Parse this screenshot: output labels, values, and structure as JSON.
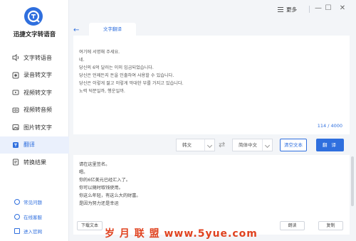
{
  "app": {
    "name": "迅捷文字转语音",
    "brand_color": "#2f6fde"
  },
  "titlebar": {
    "menu_label": "更多",
    "minimize": "—",
    "maximize": "☐",
    "close": "✕"
  },
  "sidebar": {
    "items": [
      {
        "label": "文字转语音",
        "icon": "text-to-speech-icon",
        "active": false
      },
      {
        "label": "录音转文字",
        "icon": "recording-icon",
        "active": false
      },
      {
        "label": "视频转文字",
        "icon": "video-icon",
        "active": false
      },
      {
        "label": "视频转音频",
        "icon": "video-audio-icon",
        "active": false
      },
      {
        "label": "图片转文字",
        "icon": "image-icon",
        "active": false
      },
      {
        "label": "翻译",
        "icon": "translate-icon",
        "active": true
      },
      {
        "label": "转换结果",
        "icon": "result-icon",
        "active": false
      }
    ],
    "bottom_links": [
      {
        "label": "常见问题",
        "icon": "faq-icon"
      },
      {
        "label": "在线客服",
        "icon": "support-icon"
      },
      {
        "label": "进入官网",
        "icon": "website-icon"
      }
    ]
  },
  "tabs": {
    "back": "←",
    "active_tab": "文字翻译"
  },
  "input": {
    "lines": [
      "여기에 서명해 주세요.",
      "네.",
      "당신의 6억 달러는 이미 입금되었습니다.",
      "당신은 언제든지 돈을 인출하여 사용할 수 있습니다.",
      "당신은 이렇게 젊고 이렇게 막대한 부를 가지고 있습니다.",
      "노력 덕분일까, 행운일까."
    ],
    "counter": "114 / 4000"
  },
  "controls": {
    "source_lang": "韩文",
    "target_lang": "简体中文",
    "swap": "⇄",
    "clear_label": "清空文本",
    "translate_label": "翻 译"
  },
  "output": {
    "lines": [
      "请在这里签名。",
      "嗯。",
      "你的6亿美元已经汇入了。",
      "你可以随时取钱使用。",
      "你这么年轻，有这么大的财富。",
      "是因为努力还是幸运"
    ],
    "download_label": "下载文本",
    "read_label": "朗读",
    "copy_label": "复制"
  },
  "watermark": "岁 月 联 盟   www.5yue.com"
}
